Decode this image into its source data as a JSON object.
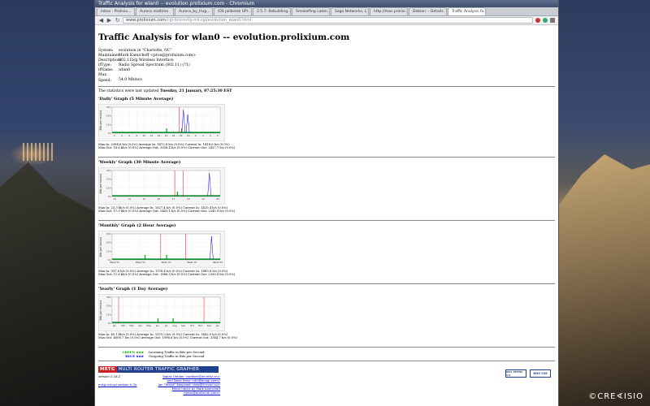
{
  "window": {
    "title": "Traffic Analysis for wlan0 -- evolution.prolixium.com - Chromium"
  },
  "tabs": [
    {
      "label": "Inbox - Prolixiu..."
    },
    {
      "label": "Aurora realtime"
    },
    {
      "label": "Aurora_by_Hug..."
    },
    {
      "label": "iOS jailbreak UPr..."
    },
    {
      "label": "2.5.7: Rebuilding..."
    },
    {
      "label": "SmokePing Laten..."
    },
    {
      "label": "Sago Networks, L..."
    },
    {
      "label": "http://mac.prolixi..."
    },
    {
      "label": "Debian -- Details ..."
    },
    {
      "label": "Traffic Analysis fo..."
    }
  ],
  "toolbar": {
    "back": "◀",
    "forward": "▶",
    "reload": "↻",
    "url_host": "www.prolixium.com",
    "url_path": "/cgi-bin/mrtg-rrd.cgi/evolution_wlan0.html"
  },
  "page": {
    "title": "Traffic Analysis for wlan0 -- evolution.prolixium.com",
    "info": [
      {
        "k": "System:",
        "v": "evolution in \"Charlotte, NC\""
      },
      {
        "k": "Maintainer:",
        "v": "Mark Kamichoff <prox@prolixium.com>"
      },
      {
        "k": "Description:",
        "v": "802.11b/g Wireless Interface"
      },
      {
        "k": "ifType:",
        "v": "Radio Spread Spectrum (802.11) (71)"
      },
      {
        "k": "ifName:",
        "v": "wlan0"
      },
      {
        "k": "Max Speed:",
        "v": "54.0 Mbits/s"
      }
    ],
    "updated_prefix": "The statistics were last updated ",
    "updated_value": "Tuesday, 21 January, 07:25:30 EST"
  },
  "graphs": [
    {
      "title": "'Daily' Graph (5 Minute Average)",
      "ylabel": "Bits per second",
      "yticks": [
        "30 k",
        "20 k",
        "10 k",
        "0 k"
      ],
      "xticks": [
        "2",
        "4",
        "6",
        "8",
        "10",
        "12",
        "14",
        "16",
        "18",
        "20",
        "22",
        "0",
        "2",
        "4",
        "6"
      ],
      "stats": [
        "Max In: 2384.6 b/s (0.0%)      Average In: 1472.8 b/s (0.0%)      Current In: 1418.6 b/s (0.0%)",
        "Max Out: 18.6 kb/s (0.0%)      Average Out: 3836.4 b/s (0.0%)      Current Out: 2427.7 b/s (0.0%)"
      ]
    },
    {
      "title": "'Weekly' Graph (30 Minute Average)",
      "ylabel": "Bits per second",
      "yticks": [
        "30 k",
        "20 k",
        "10 k",
        "0 k"
      ],
      "xticks": [
        "13",
        "14",
        "15",
        "16",
        "17",
        "18",
        "19",
        "20"
      ],
      "stats": [
        "Max In: 23.3 kb/s (0.0%)      Average In: 1627.4 b/s (0.0%)      Current In: 1420.4 b/s (0.0%)",
        "Max Out: 17.0 kb/s (0.0%)      Average Out: 2443.1 b/s (0.0%)      Current Out: 2245.0 b/s (0.0%)"
      ]
    },
    {
      "title": "'Monthly' Graph (2 Hour Average)",
      "ylabel": "Bits per second",
      "yticks": [
        "30 k",
        "20 k",
        "10 k",
        "0 k"
      ],
      "xticks": [
        "Week 51",
        "Week 52",
        "Week 01",
        "Week 02",
        "Week 03"
      ],
      "stats": [
        "Max In: 937.6 b/s (0.0%)      Average In: 1378.4 b/s (0.0%)      Current In: 1489.8 b/s (0.0%)",
        "Max Out: 11.6 kb/s (0.0%)      Average Out: 1888.5 b/s (0.0%)      Current Out: 2300.8 b/s (0.0%)"
      ]
    },
    {
      "title": "'Yearly' Graph (1 Day Average)",
      "ylabel": "Bits per second",
      "yticks": [
        "30 k",
        "20 k",
        "10 k",
        "0 k"
      ],
      "xticks": [
        "Jan",
        "Feb",
        "Mar",
        "Apr",
        "May",
        "Jun",
        "Jul",
        "Aug",
        "Sep",
        "Oct",
        "Nov",
        "Dec",
        "Jan"
      ],
      "stats": [
        "Max In: 40.1 kb/s (0.0%)      Average In: 1975.3 b/s (0.0%)      Current In: 1482.0 b/s (0.0%)",
        "Max Out: 4008.7 b/s (0.0%)      Average Out: 1096.6 b/s (0.0%)      Current Out: 2344.7 b/s (0.0%)"
      ]
    }
  ],
  "legend": [
    {
      "key": "GREEN ###",
      "color": "#00aa00",
      "text": "Incoming Traffic in Bits per Second"
    },
    {
      "key": "BLUE ###",
      "color": "#0000ff",
      "text": "Outgoing Traffic in Bits per Second"
    }
  ],
  "footer": {
    "logo_m": "MRTG",
    "logo_text": "MULTI ROUTER TRAFFIC GRAPHER",
    "version": "version 2.16.2",
    "cgi_version": "mrtg-rrd.cgi version 0.7p",
    "credits": [
      "Tobias Oetiker <oetiker@ee.ethz.ch>",
      "and Dave Rand <dlr@bungi.com>",
      "Jan \"Yenya\" Kasprzak <kas@fi.muni.cz>",
      "Minor hacks by Mark Kamichoff <prox@prolixium.com>"
    ],
    "badge1": "W3C XHTML 1.0",
    "badge2": "W3C CSS"
  },
  "watermark": "©CRE∢ISIO",
  "colors": {
    "in": "#00aa00",
    "out": "#0000ff",
    "maxline": "#ff0000"
  }
}
